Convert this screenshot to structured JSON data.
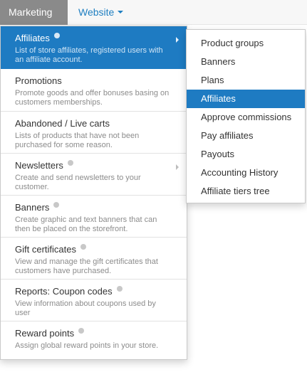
{
  "topnav": {
    "marketing": "Marketing",
    "website": "Website"
  },
  "menu": {
    "items": [
      {
        "title": "Affiliates",
        "desc": "List of store affiliates, registered users with an affiliate account."
      },
      {
        "title": "Promotions",
        "desc": "Promote goods and offer bonuses basing on customers memberships."
      },
      {
        "title": "Abandoned / Live carts",
        "desc": "Lists of products that have not been purchased for some reason."
      },
      {
        "title": "Newsletters",
        "desc": "Create and send newsletters to your customer."
      },
      {
        "title": "Banners",
        "desc": "Create graphic and text banners that can then be placed on the storefront."
      },
      {
        "title": "Gift certificates",
        "desc": "View and manage the gift certificates that customers have purchased."
      },
      {
        "title": "Reports: Coupon codes",
        "desc": "View information about coupons used by user"
      },
      {
        "title": "Reward points",
        "desc": "Assign global reward points in your store."
      }
    ]
  },
  "submenu": {
    "items": [
      "Product groups",
      "Banners",
      "Plans",
      "Affiliates",
      "Approve commissions",
      "Pay affiliates",
      "Payouts",
      "Accounting History",
      "Affiliate tiers tree"
    ]
  },
  "colors": {
    "accent": "#1e7bc2",
    "link": "#1f7fc1",
    "active_top": "#8a8a8a"
  }
}
